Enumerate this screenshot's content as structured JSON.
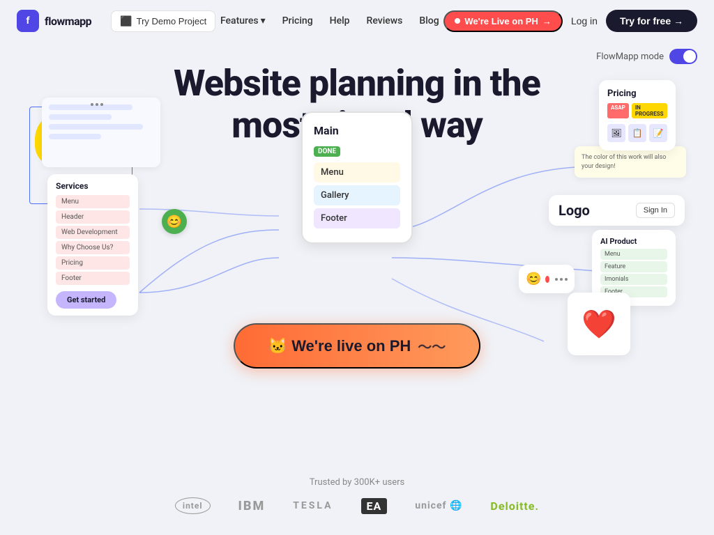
{
  "brand": {
    "name": "flowmapp",
    "logo_letter": "f"
  },
  "navbar": {
    "demo_label": "Try Demo Project",
    "features_label": "Features",
    "pricing_label": "Pricing",
    "help_label": "Help",
    "reviews_label": "Reviews",
    "blog_label": "Blog",
    "live_label": "We're Live on PH",
    "login_label": "Log in",
    "try_label": "Try for free →"
  },
  "flowmapp_mode": {
    "label": "FlowMapp mode"
  },
  "hero": {
    "title_line1": "Website planning in the",
    "title_line2": "most visual way"
  },
  "cta": {
    "label": "🐱 We're live on PH"
  },
  "mind_map": {
    "title": "Main",
    "badge": "DONE",
    "items": [
      "Menu",
      "Gallery",
      "Footer"
    ]
  },
  "services_card": {
    "title": "Services",
    "items": [
      "Menu",
      "Header",
      "Web Development",
      "Why Choose Us?",
      "Pricing",
      "Footer"
    ],
    "cta": "Get started"
  },
  "pricing_card": {
    "title": "Pricing",
    "badge_asap": "ASAP",
    "badge_progress": "IN PROGRESS"
  },
  "logo_card": {
    "logo": "Logo",
    "signin": "Sign In"
  },
  "ai_card": {
    "title": "AI Product",
    "items": [
      "Menu",
      "Feature",
      "Imonials",
      "Footer"
    ]
  },
  "trusted": {
    "text": "Trusted by 300K+ users",
    "brands": [
      "intel",
      "IBM",
      "TESLA",
      "EA",
      "unicef",
      "Deloitte."
    ]
  }
}
